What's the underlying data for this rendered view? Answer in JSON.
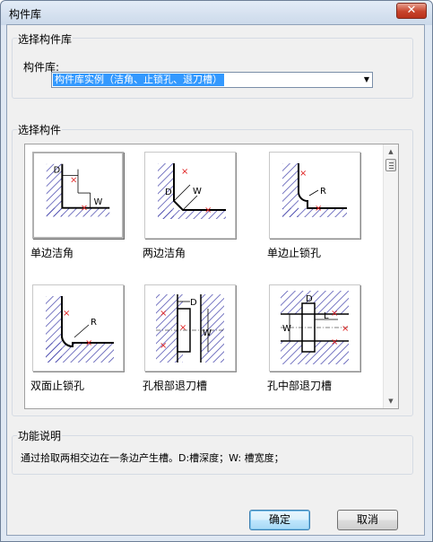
{
  "window": {
    "title": "构件库",
    "close_glyph": "✕"
  },
  "library_section": {
    "group_label": "选择构件库",
    "field_label": "构件库:",
    "selected_value": "构件库实例（洁角、止锁孔、退刀槽）"
  },
  "component_section": {
    "group_label": "选择构件",
    "items": [
      {
        "label": "单边洁角",
        "selected": true
      },
      {
        "label": "两边洁角",
        "selected": false
      },
      {
        "label": "单边止锁孔",
        "selected": false
      },
      {
        "label": "双面止锁孔",
        "selected": false
      },
      {
        "label": "孔根部退刀槽",
        "selected": false
      },
      {
        "label": "孔中部退刀槽",
        "selected": false
      }
    ],
    "diagram_letters": {
      "item1": [
        "D",
        "W"
      ],
      "item2": [
        "D",
        "W"
      ],
      "item3": [
        "R"
      ],
      "item4": [
        "R"
      ],
      "item5": [
        "D",
        "W"
      ],
      "item6": [
        "D",
        "L",
        "W"
      ]
    }
  },
  "description_section": {
    "group_label": "功能说明",
    "text": "通过拾取两相交边在一条边产生槽。D:槽深度；W: 槽宽度；"
  },
  "buttons": {
    "ok": "确定",
    "cancel": "取消"
  },
  "colors": {
    "hatch": "#3a3aa8",
    "marker": "#e02020",
    "selection": "#3399ff"
  }
}
